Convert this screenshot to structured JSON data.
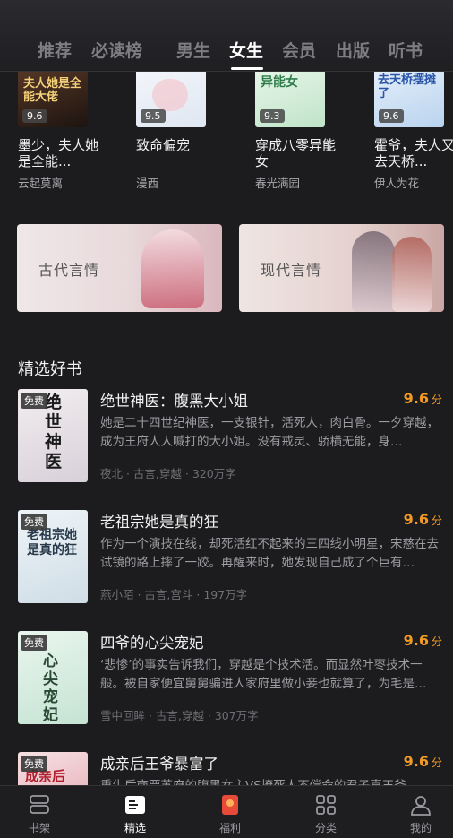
{
  "top_tabs": [
    {
      "label": "推荐"
    },
    {
      "label": "必读榜"
    },
    {
      "label": "男生"
    },
    {
      "label": "女生"
    },
    {
      "label": "会员"
    },
    {
      "label": "出版"
    },
    {
      "label": "听书"
    }
  ],
  "active_tab_index": 3,
  "row_books": [
    {
      "title": "墨少，夫人她是全能...",
      "author": "云起莫离",
      "score": "9.6",
      "cover_text": "夫人她是全能大佬",
      "color": "#3a2a20"
    },
    {
      "title": "致命偏宠",
      "author": "漫西",
      "score": "9.5",
      "cover_text": "",
      "color": "#e8eef5"
    },
    {
      "title": "穿成八零异能女",
      "author": "春光满园",
      "score": "9.3",
      "cover_text": "异能女",
      "color": "#d9efe0"
    },
    {
      "title": "霍爷，夫人又去天桥...",
      "author": "伊人为花",
      "score": "9.6",
      "cover_text": "去天桥摆摊了",
      "color": "#d7e6f5"
    }
  ],
  "banners": [
    {
      "label": "古代言情"
    },
    {
      "label": "现代言情"
    }
  ],
  "section_title": "精选好书",
  "books": [
    {
      "badge": "免费",
      "title": "绝世神医：腹黑大小姐",
      "score": "9.6",
      "score_unit": "分",
      "desc": "她是二十四世纪神医，一支银针，活死人，肉白骨。一夕穿越，成为王府人人喊打的大小姐。没有戒灵、骄横无能，身…",
      "meta": "夜北 · 古言,穿越 · 320万字",
      "cover_text": "绝世神医"
    },
    {
      "badge": "免费",
      "title": "老祖宗她是真的狂",
      "score": "9.6",
      "score_unit": "分",
      "desc": "作为一个演技在线，却死活红不起来的三四线小明星，宋慈在去试镜的路上摔了一跤。再醒来时，她发现自己成了个巨有…",
      "meta": "燕小陌 · 古言,宫斗 · 197万字",
      "cover_text": "老祖宗她是真的狂"
    },
    {
      "badge": "免费",
      "title": "四爷的心尖宠妃",
      "score": "9.6",
      "score_unit": "分",
      "desc": "‘悲惨’的事实告诉我们，穿越是个技术活。而显然叶枣技术一般。被自家便宜舅舅骗进人家府里做小妾也就算了，为毛是…",
      "meta": "雪中回眸 · 古言,穿越 · 307万字",
      "cover_text": "心尖宠妃"
    },
    {
      "badge": "免费",
      "title": "成亲后王爷暴富了",
      "score": "9.6",
      "score_unit": "分",
      "desc": "重生后商贾苏府的腹黑女主VS撩死人不偿命的君子嘉王爷",
      "meta": "",
      "cover_text": "成亲后"
    }
  ],
  "bottom_nav": [
    {
      "label": "书架",
      "icon": "bookshelf-icon"
    },
    {
      "label": "精选",
      "icon": "featured-icon"
    },
    {
      "label": "福利",
      "icon": "gift-icon"
    },
    {
      "label": "分类",
      "icon": "category-icon"
    },
    {
      "label": "我的",
      "icon": "profile-icon"
    }
  ],
  "active_nav_index": 1,
  "colors": {
    "accent": "#f39a25",
    "background": "#1c1c1e"
  }
}
